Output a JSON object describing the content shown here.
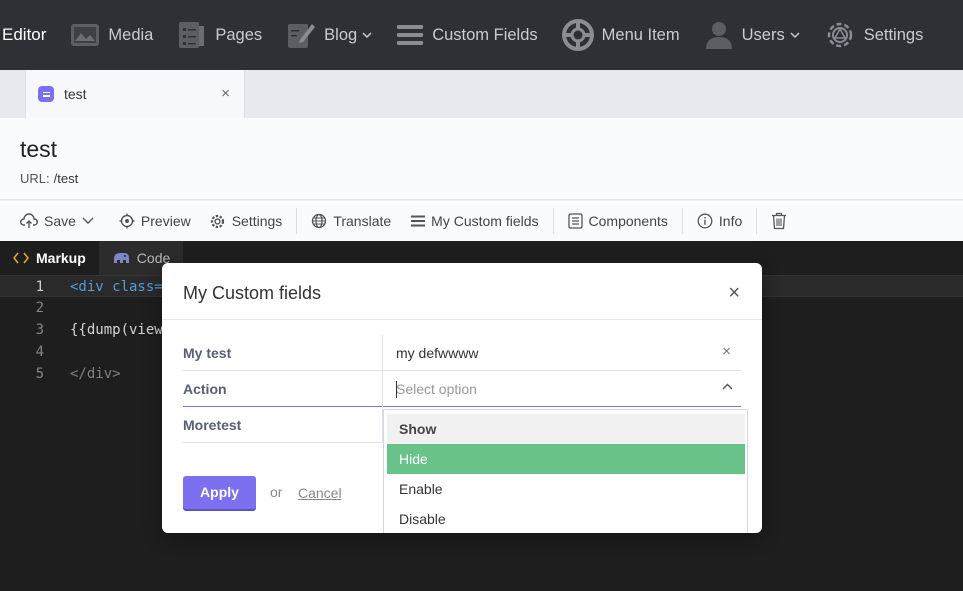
{
  "nav": {
    "brand": "Editor",
    "items": [
      {
        "label": "Media",
        "icon": "media-icon"
      },
      {
        "label": "Pages",
        "icon": "pages-icon"
      },
      {
        "label": "Blog",
        "icon": "blog-icon"
      },
      {
        "label": "Custom Fields",
        "icon": "custom-fields-icon"
      },
      {
        "label": "Menu Item",
        "icon": "menu-item-icon"
      },
      {
        "label": "Users",
        "icon": "users-icon"
      },
      {
        "label": "Settings",
        "icon": "settings-icon"
      }
    ]
  },
  "tab": {
    "label": "test",
    "close": "×"
  },
  "page": {
    "title": "test",
    "url_label": "URL:",
    "url_value": "/test"
  },
  "toolbar": {
    "save": "Save",
    "preview": "Preview",
    "settings": "Settings",
    "translate": "Translate",
    "custom_fields": "My Custom fields",
    "components": "Components",
    "info": "Info"
  },
  "editor": {
    "tabs": [
      "Markup",
      "Code"
    ],
    "lines": [
      {
        "n": "1",
        "text": "<div class="
      },
      {
        "n": "2",
        "text": ""
      },
      {
        "n": "3",
        "text": "{{dump(view"
      },
      {
        "n": "4",
        "text": ""
      },
      {
        "n": "5",
        "text": "</div>"
      }
    ]
  },
  "modal": {
    "title": "My Custom fields",
    "close": "×",
    "fields": [
      {
        "label": "My test",
        "value": "my defwwww",
        "clear": "×"
      },
      {
        "label": "Action",
        "placeholder": "Select option"
      },
      {
        "label": "Moretest"
      }
    ],
    "options": [
      "Show",
      "Hide",
      "Enable",
      "Disable"
    ],
    "selected_option": "Hide",
    "apply": "Apply",
    "or": "or",
    "cancel": "Cancel"
  },
  "colors": {
    "accent": "#7c6ff0",
    "selected": "#6ac28b",
    "nav_bg": "#2d3034",
    "editor_bg": "#1e1e1e"
  }
}
